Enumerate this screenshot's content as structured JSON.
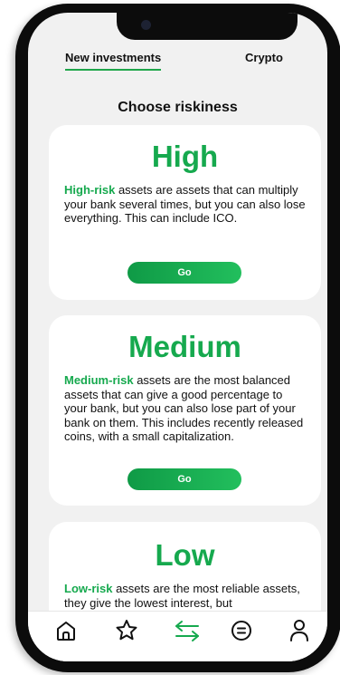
{
  "tabs": [
    {
      "label": "New investments",
      "active": true
    },
    {
      "label": "Crypto",
      "active": false
    }
  ],
  "page_title": "Choose riskiness",
  "cards": [
    {
      "heading": "High",
      "highlight": "High-risk",
      "text": " assets are assets that can multiply your bank several times, but you can also lose everything. This can include ICO.",
      "button": "Go"
    },
    {
      "heading": "Medium",
      "highlight": "Medium-risk",
      "text": " assets are the most balanced assets that can give a good percentage to your bank, but you can also lose part of your bank on them. This includes recently released coins, with a small capitalization.",
      "button": "Go"
    },
    {
      "heading": "Low",
      "highlight": "Low-risk",
      "text": " assets are the most reliable assets, they give the lowest interest, but"
    }
  ],
  "bottom_nav": [
    {
      "icon": "home-icon"
    },
    {
      "icon": "star-icon"
    },
    {
      "icon": "exchange-icon",
      "active": true
    },
    {
      "icon": "document-icon"
    },
    {
      "icon": "profile-icon"
    }
  ],
  "colors": {
    "accent": "#16a94e",
    "background": "#f1f1f1",
    "card": "#ffffff",
    "text": "#111111"
  }
}
